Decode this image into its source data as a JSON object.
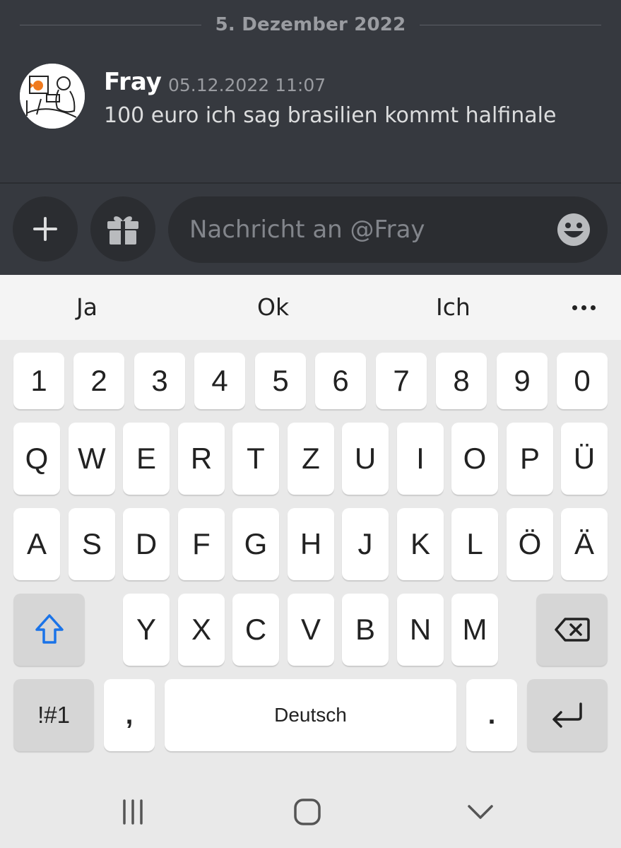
{
  "chat": {
    "date_separator": "5. Dezember 2022",
    "message": {
      "author": "Fray",
      "timestamp": "05.12.2022 11:07",
      "text": "100 euro ich sag brasilien kommt halfinale"
    }
  },
  "composer": {
    "placeholder": "Nachricht an @Fray",
    "plus_icon": "plus-icon",
    "gift_icon": "gift-icon",
    "emoji_icon": "emoji-icon"
  },
  "suggestions": [
    "Ja",
    "Ok",
    "Ich"
  ],
  "keyboard": {
    "numbers": [
      "1",
      "2",
      "3",
      "4",
      "5",
      "6",
      "7",
      "8",
      "9",
      "0"
    ],
    "row1": [
      "Q",
      "W",
      "E",
      "R",
      "T",
      "Z",
      "U",
      "I",
      "O",
      "P",
      "Ü"
    ],
    "row2": [
      "A",
      "S",
      "D",
      "F",
      "G",
      "H",
      "J",
      "K",
      "L",
      "Ö",
      "Ä"
    ],
    "row3": [
      "Y",
      "X",
      "C",
      "V",
      "B",
      "N",
      "M"
    ],
    "symbols_label": "!#1",
    "comma": ",",
    "space_label": "Deutsch",
    "period": ".",
    "shift_icon": "shift-icon",
    "backspace_icon": "backspace-icon",
    "enter_icon": "enter-icon"
  },
  "navbar": {
    "recent_icon": "recent-apps-icon",
    "home_icon": "home-icon",
    "back_icon": "back-icon"
  },
  "colors": {
    "chat_bg": "#36393f",
    "pill_bg": "#2b2d31",
    "shift_accent": "#1a73e8",
    "keyboard_bg": "#e9e9e9"
  }
}
